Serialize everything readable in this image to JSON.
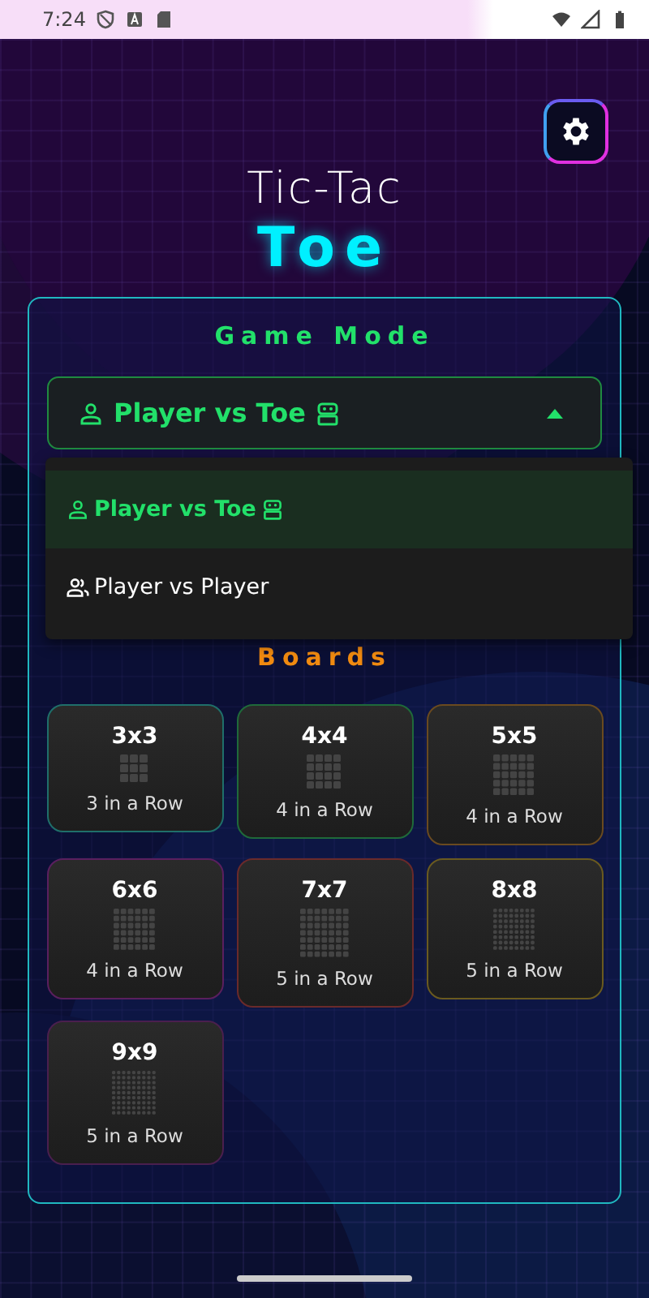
{
  "status_bar": {
    "time": "7:24"
  },
  "title": {
    "line_1": "Tic-Tac",
    "line_2": "Toe"
  },
  "game_mode": {
    "heading": "Game Mode",
    "value": "Player vs Toe",
    "expanded": true,
    "options": [
      {
        "label": "Player vs Toe",
        "kind": "ai",
        "selected": true
      },
      {
        "label": "Player vs Player",
        "kind": "pvp",
        "selected": false
      }
    ]
  },
  "boards": {
    "heading": "Boards",
    "items": [
      {
        "label": "3x3",
        "caption": "3 in a Row",
        "color": "#1f6f6a"
      },
      {
        "label": "4x4",
        "caption": "4 in a Row",
        "color": "#1f6a3a"
      },
      {
        "label": "5x5",
        "caption": "4 in a Row",
        "color": "#6a4a1f"
      },
      {
        "label": "6x6",
        "caption": "4 in a Row",
        "color": "#5a1f5e"
      },
      {
        "label": "7x7",
        "caption": "5 in a Row",
        "color": "#6a2a2a"
      },
      {
        "label": "8x8",
        "caption": "5 in a Row",
        "color": "#6a5a1f"
      },
      {
        "label": "9x9",
        "caption": "5 in a Row",
        "color": "#4a1f4e"
      }
    ]
  }
}
